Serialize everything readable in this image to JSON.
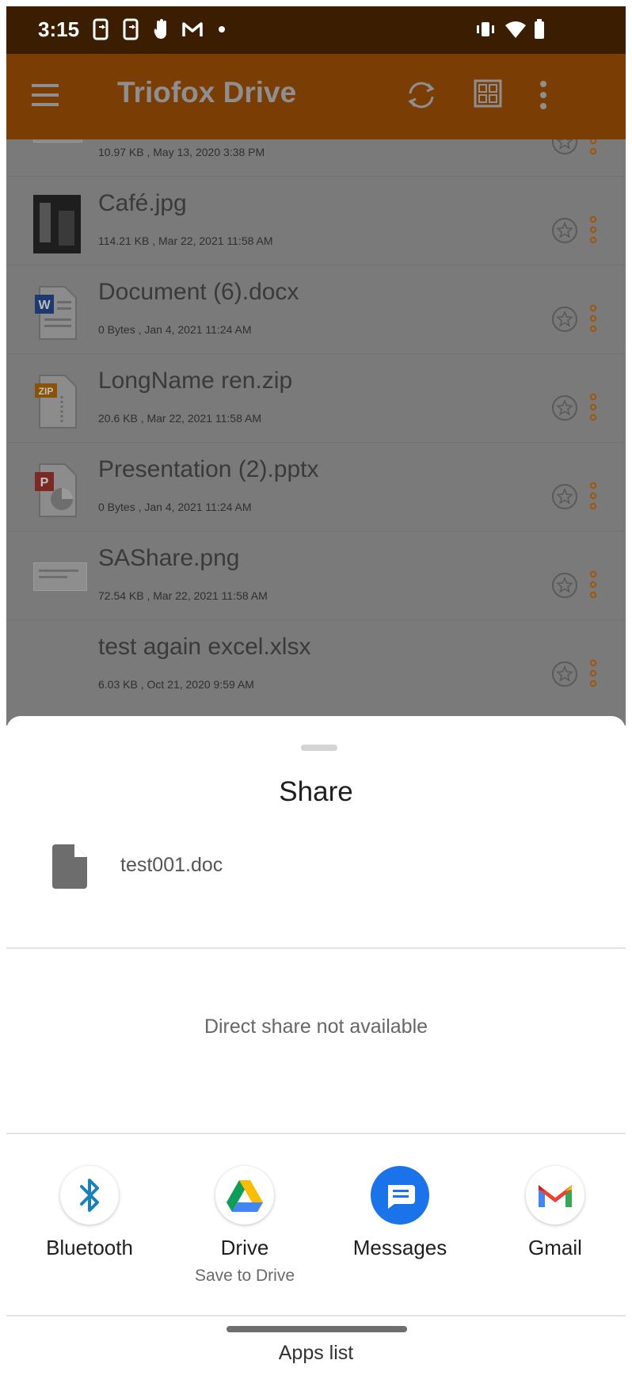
{
  "status_bar": {
    "time": "3:15",
    "left_icons": [
      "phone-share-icon",
      "phone-share-icon",
      "hand-icon",
      "gmail-icon",
      "dot-icon"
    ],
    "right_icons": [
      "vibrate-icon",
      "wifi-icon",
      "battery-icon"
    ]
  },
  "app_bar": {
    "title": "Triofox Drive",
    "icons": [
      "menu-icon",
      "sync-icon",
      "grid-view-icon",
      "more-vert-icon"
    ]
  },
  "files": [
    {
      "name": "",
      "meta": "10.97 KB , May 13, 2020 3:38 PM",
      "icon": "image-thumb-icon"
    },
    {
      "name": "Café.jpg",
      "meta": "114.21 KB , Mar 22, 2021 11:58 AM",
      "icon": "photo-thumb-icon"
    },
    {
      "name": "Document (6).docx",
      "meta": "0 Bytes , Jan 4, 2021 11:24 AM",
      "icon": "word-doc-icon"
    },
    {
      "name": "LongName ren.zip",
      "meta": "20.6 KB , Mar 22, 2021 11:58 AM",
      "icon": "zip-file-icon"
    },
    {
      "name": "Presentation (2).pptx",
      "meta": "0 Bytes , Jan 4, 2021 11:24 AM",
      "icon": "powerpoint-icon"
    },
    {
      "name": "SAShare.png",
      "meta": "72.54 KB , Mar 22, 2021 11:58 AM",
      "icon": "screenshot-thumb-icon"
    },
    {
      "name": "test again excel.xlsx",
      "meta": "6.03 KB , Oct 21, 2020 9:59 AM",
      "icon": ""
    }
  ],
  "share_sheet": {
    "title": "Share",
    "file_name": "test001.doc",
    "direct_share_message": "Direct share not available",
    "apps": [
      {
        "label": "Bluetooth",
        "sublabel": "",
        "icon": "bluetooth-icon"
      },
      {
        "label": "Drive",
        "sublabel": "Save to Drive",
        "icon": "google-drive-icon"
      },
      {
        "label": "Messages",
        "sublabel": "",
        "icon": "messages-icon"
      },
      {
        "label": "Gmail",
        "sublabel": "",
        "icon": "gmail-icon"
      }
    ],
    "apps_list_label": "Apps list"
  },
  "colors": {
    "status_bar": "#3b1e02",
    "app_bar": "#7a3e04",
    "scrim_list": "#7a7a7a",
    "accent_orange": "#a0560a",
    "messages_blue": "#1a73e8"
  }
}
